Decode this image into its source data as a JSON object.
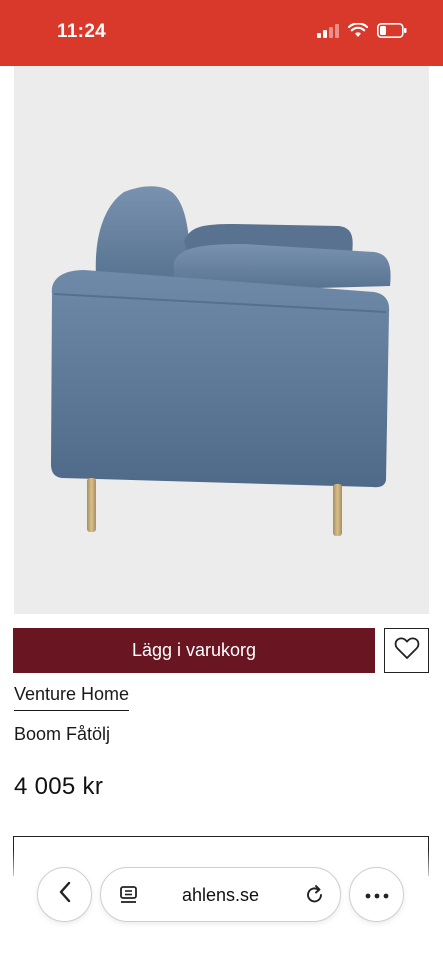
{
  "status_bar": {
    "time": "11:24",
    "bg_color": "#d9392b",
    "icons": [
      "signal-icon",
      "wifi-icon",
      "battery-icon"
    ]
  },
  "product": {
    "image_alt": "sofa-image",
    "add_to_cart_label": "Lägg i varukorg",
    "add_to_cart_color": "#6a1522",
    "brand": "Venture Home",
    "name": "Boom Fåtölj",
    "price": "4 005 kr"
  },
  "browser": {
    "url": "ahlens.se",
    "icons": [
      "back-chevron-icon",
      "reader-icon",
      "reload-icon",
      "more-icon"
    ]
  }
}
